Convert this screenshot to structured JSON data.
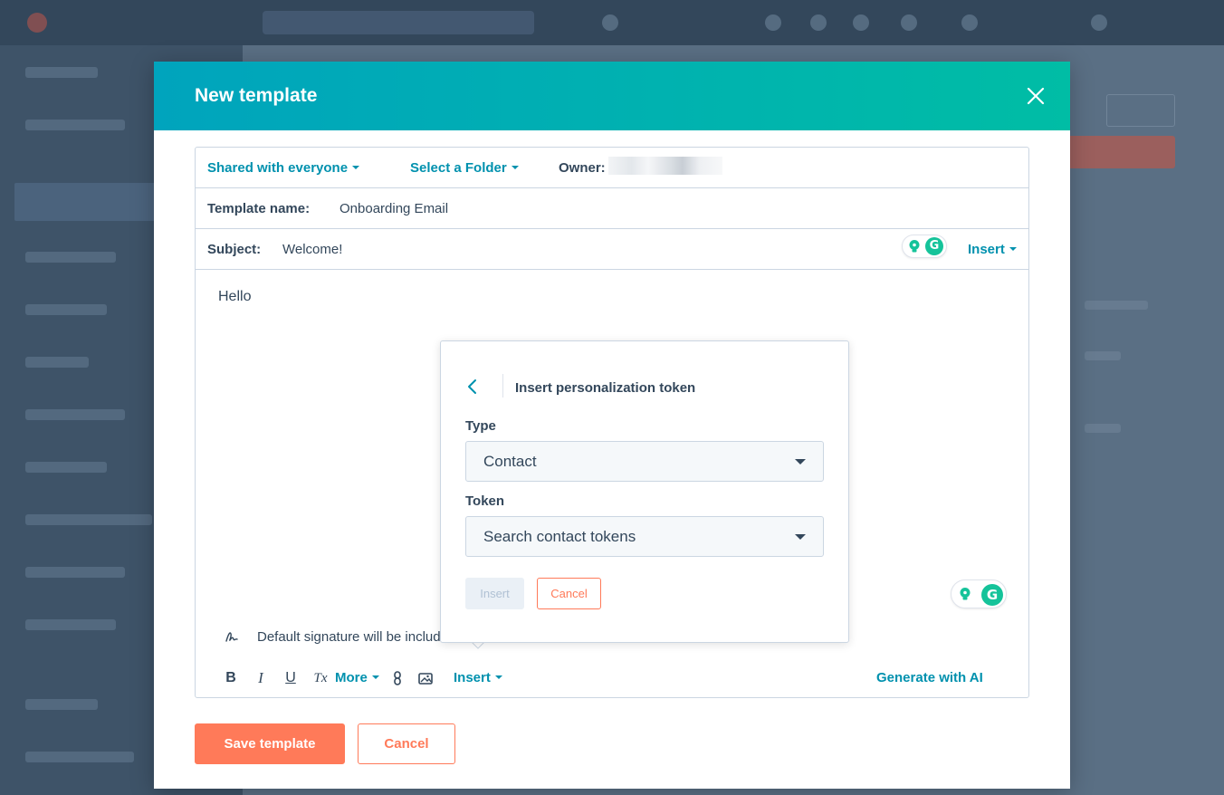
{
  "modal": {
    "title": "New template",
    "sharing_label": "Shared with everyone",
    "folder_label": "Select a Folder",
    "owner_label": "Owner:",
    "template_name_label": "Template name:",
    "template_name_value": "Onboarding Email",
    "subject_label": "Subject:",
    "subject_value": "Welcome!",
    "subject_insert_label": "Insert",
    "body_text": "Hello",
    "signature_text": "Default signature will be included",
    "toolbar": {
      "bold": "B",
      "italic": "I",
      "underline": "U",
      "clear_format": "Tx",
      "more_label": "More",
      "insert_label": "Insert",
      "generate_label": "Generate with AI"
    },
    "save_button": "Save template",
    "cancel_button": "Cancel"
  },
  "popover": {
    "title": "Insert personalization token",
    "type_label": "Type",
    "type_value": "Contact",
    "token_label": "Token",
    "token_placeholder": "Search contact tokens",
    "insert_button": "Insert",
    "cancel_button": "Cancel"
  },
  "colors": {
    "header_gradient_start": "#00a4bd",
    "header_gradient_end": "#00bda5",
    "link": "#0091ae",
    "primary_button": "#ff7a59",
    "text": "#33475b",
    "border": "#cbd6e2",
    "grammarly": "#15c39a"
  }
}
